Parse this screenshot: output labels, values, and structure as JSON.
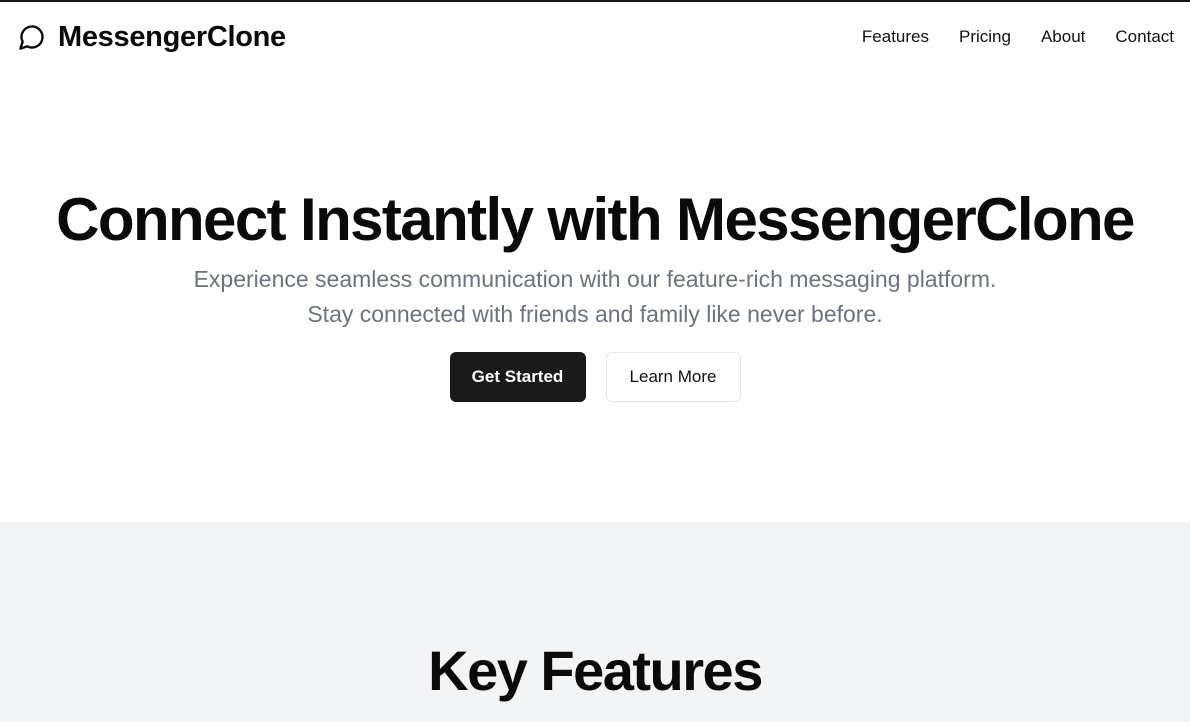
{
  "header": {
    "brand_name": "MessengerClone",
    "brand_icon": "message-circle-icon",
    "nav": [
      {
        "label": "Features"
      },
      {
        "label": "Pricing"
      },
      {
        "label": "About"
      },
      {
        "label": "Contact"
      }
    ]
  },
  "hero": {
    "title": "Connect Instantly with MessengerClone",
    "subtitle": "Experience seamless communication with our feature-rich messaging platform. Stay connected with friends and family like never before.",
    "primary_cta": "Get Started",
    "secondary_cta": "Learn More"
  },
  "features": {
    "title": "Key Features"
  },
  "colors": {
    "primary_button": "#1a1a1a",
    "muted_text": "#6b7280",
    "section_bg": "#f3f4f6"
  }
}
